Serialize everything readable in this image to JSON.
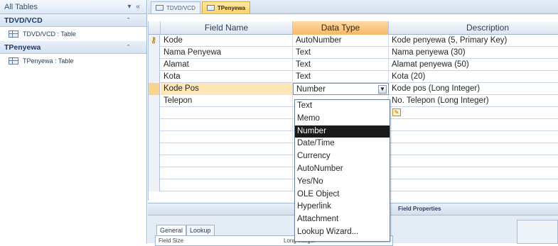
{
  "nav": {
    "header": "All Tables",
    "groups": [
      {
        "title": "TDVD/VCD",
        "item": "TDVD/VCD : Table"
      },
      {
        "title": "TPenyewa",
        "item": "TPenyewa : Table"
      }
    ]
  },
  "tabs": [
    "TDVD/VCD",
    "TPenyewa"
  ],
  "grid": {
    "headers": {
      "field_name": "Field Name",
      "data_type": "Data Type",
      "description": "Description"
    },
    "rows": [
      {
        "name": "Kode",
        "type": "AutoNumber",
        "desc": "Kode penyewa (5, Primary Key)"
      },
      {
        "name": "Nama Penyewa",
        "type": "Text",
        "desc": "Nama penyewa (30)"
      },
      {
        "name": "Alamat",
        "type": "Text",
        "desc": "Alamat penyewa (50)"
      },
      {
        "name": "Kota",
        "type": "Text",
        "desc": "Kota (20)"
      },
      {
        "name": "Kode Pos",
        "type": "Number",
        "desc": "Kode pos (Long Integer)"
      },
      {
        "name": "Telepon",
        "type": "",
        "desc": "No. Telepon (Long Integer)"
      }
    ]
  },
  "dropdown": {
    "options": [
      "Text",
      "Memo",
      "Number",
      "Date/Time",
      "Currency",
      "AutoNumber",
      "Yes/No",
      "OLE Object",
      "Hyperlink",
      "Attachment",
      "Lookup Wizard..."
    ],
    "selected": "Number"
  },
  "field_properties": {
    "title": "Field Properties",
    "tabs": [
      "General",
      "Lookup"
    ],
    "row_label": "Field Size",
    "row_value": "Long Integer"
  },
  "colors": {
    "active_tab": "#fcd56a",
    "selected_header": "#f7b866",
    "selected_option": "#1a1a1a"
  }
}
